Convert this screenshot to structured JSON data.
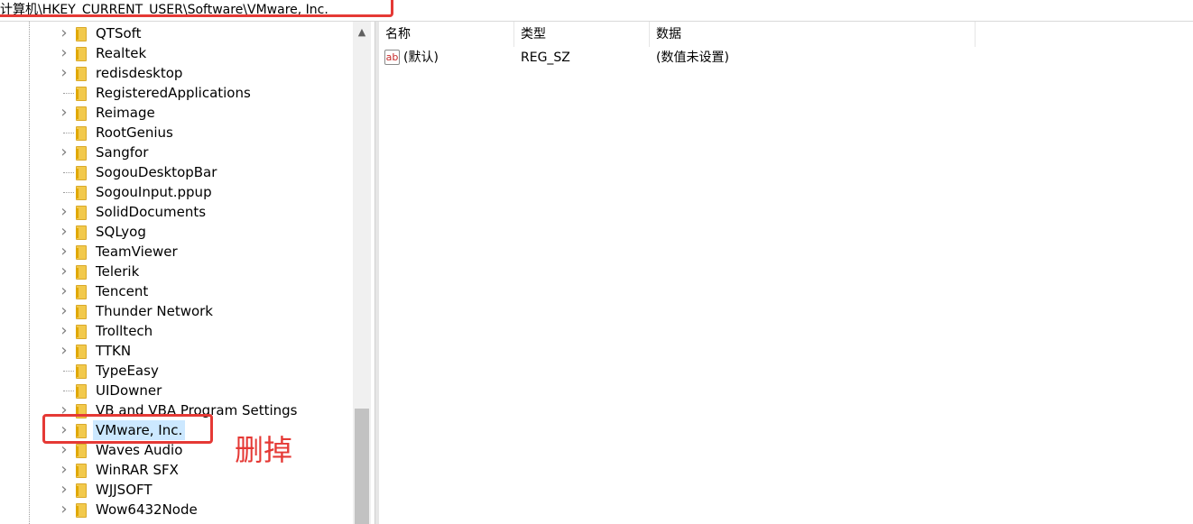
{
  "address": {
    "path": "计算机\\HKEY_CURRENT_USER\\Software\\VMware, Inc."
  },
  "tree": {
    "scroll_up_icon": "chevron-up",
    "items": [
      {
        "label": "QTSoft",
        "expandable": true
      },
      {
        "label": "Realtek",
        "expandable": true
      },
      {
        "label": "redisdesktop",
        "expandable": true
      },
      {
        "label": "RegisteredApplications",
        "expandable": false
      },
      {
        "label": "Reimage",
        "expandable": true
      },
      {
        "label": "RootGenius",
        "expandable": false
      },
      {
        "label": "Sangfor",
        "expandable": true
      },
      {
        "label": "SogouDesktopBar",
        "expandable": false
      },
      {
        "label": "SogouInput.ppup",
        "expandable": false
      },
      {
        "label": "SolidDocuments",
        "expandable": true
      },
      {
        "label": "SQLyog",
        "expandable": true
      },
      {
        "label": "TeamViewer",
        "expandable": true
      },
      {
        "label": "Telerik",
        "expandable": true
      },
      {
        "label": "Tencent",
        "expandable": true
      },
      {
        "label": "Thunder Network",
        "expandable": true
      },
      {
        "label": "Trolltech",
        "expandable": true
      },
      {
        "label": "TTKN",
        "expandable": true
      },
      {
        "label": "TypeEasy",
        "expandable": false
      },
      {
        "label": "UIDowner",
        "expandable": false
      },
      {
        "label": "VB and VBA Program Settings",
        "expandable": true
      },
      {
        "label": "VMware, Inc.",
        "expandable": true,
        "selected": true
      },
      {
        "label": "Waves Audio",
        "expandable": true
      },
      {
        "label": "WinRAR SFX",
        "expandable": true
      },
      {
        "label": "WJJSOFT",
        "expandable": true
      },
      {
        "label": "Wow6432Node",
        "expandable": true
      }
    ]
  },
  "annotation": {
    "text": "删掉",
    "color": "#e53935"
  },
  "values_panel": {
    "columns": [
      "名称",
      "类型",
      "数据"
    ],
    "rows": [
      {
        "icon": "string-value-icon",
        "icon_text": "ab",
        "name": "(默认)",
        "type": "REG_SZ",
        "data": "(数值未设置)"
      }
    ]
  },
  "colors": {
    "selection": "#cce8ff",
    "highlight_box": "#e53935",
    "folder": "#f2c94c"
  }
}
